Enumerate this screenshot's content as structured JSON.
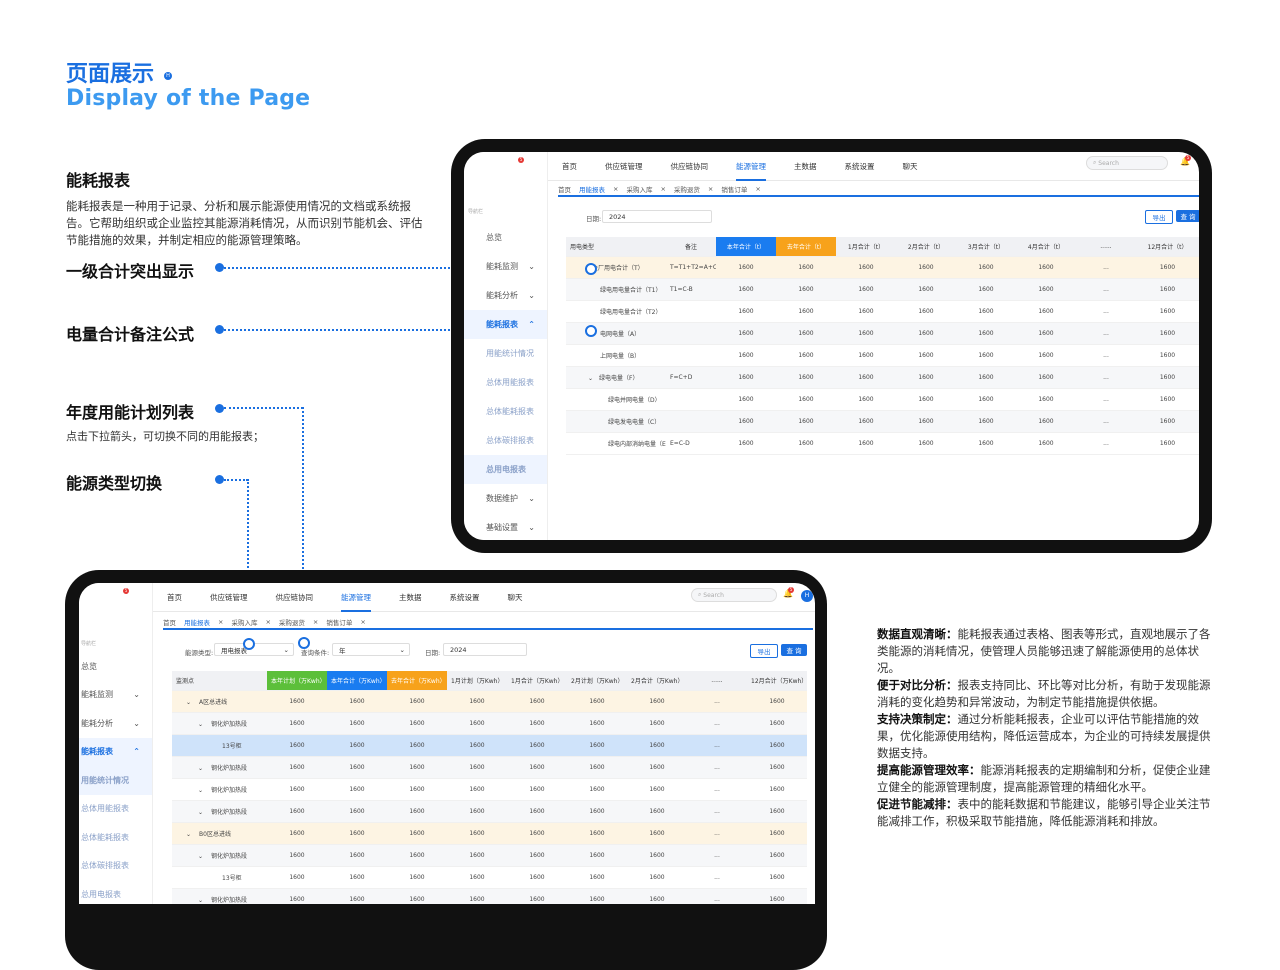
{
  "header": {
    "title_cn": "页面展示",
    "title_en": "Display of the Page",
    "mark": "H"
  },
  "section1": {
    "title": "能耗报表",
    "desc": "能耗报表是一种用于记录、分析和展示能源使用情况的文档或系统报告。它帮助组织或企业监控其能源消耗情况，从而识别节能机会、评估节能措施的效果，并制定相应的能源管理策略。"
  },
  "callouts": {
    "c1": "一级合计突出显示",
    "c2": "电量合计备注公式",
    "c3": "年度用能计划列表",
    "c3_desc": "点击下拉箭头，可切换不同的用能报表；",
    "c4": "能源类型切换"
  },
  "app": {
    "nav": [
      "首页",
      "供应链管理",
      "供应链协同",
      "能源管理",
      "主数据",
      "系统设置",
      "聊天"
    ],
    "nav_active": "能源管理",
    "chat_badge": "5",
    "bell_badge": "5",
    "search_placeholder": "Search",
    "avatar": "H",
    "tabs": [
      "首页",
      "用能报表",
      "采购入库",
      "采购退货",
      "销售订单"
    ],
    "tabs_active": "用能报表",
    "sidebar_caption": "导航栏",
    "sidebar": [
      {
        "label": "总览",
        "arrow": ""
      },
      {
        "label": "能耗监测",
        "arrow": "⌄"
      },
      {
        "label": "能耗分析",
        "arrow": "⌄"
      },
      {
        "label": "能耗报表",
        "arrow": "⌃"
      },
      {
        "label": "用能统计情况",
        "arrow": ""
      },
      {
        "label": "总体用能报表",
        "arrow": ""
      },
      {
        "label": "总体能耗报表",
        "arrow": ""
      },
      {
        "label": "总体碳排报表",
        "arrow": ""
      },
      {
        "label": "总用电报表",
        "arrow": ""
      },
      {
        "label": "数据维护",
        "arrow": "⌄"
      },
      {
        "label": "基础设置",
        "arrow": "⌄"
      }
    ],
    "export_label": "导出",
    "query_label": "查 询",
    "date_label": "日期:",
    "date_value": "2024"
  },
  "table1": {
    "headers": [
      "用电类型",
      "备注",
      "本年合计（t）",
      "去年合计（t）",
      "1月合计（t）",
      "2月合计（t）",
      "3月合计（t）",
      "4月合计（t）",
      "......",
      "12月合计（t）"
    ],
    "rows": [
      {
        "name": "全厂用电合计（T）",
        "note": "T=T1+T2=A+C-B",
        "vals": [
          "1600",
          "1600",
          "1600",
          "1600",
          "1600",
          "1600",
          "...",
          "1600"
        ],
        "style": "hl",
        "indent": 0,
        "caret": ""
      },
      {
        "name": "绿电用电量合计（T1）",
        "note": "T1=C-B",
        "vals": [
          "1600",
          "1600",
          "1600",
          "1600",
          "1600",
          "1600",
          "...",
          "1600"
        ],
        "style": "alt",
        "indent": 1,
        "caret": ""
      },
      {
        "name": "绿电用电量合计（T2）",
        "note": "",
        "vals": [
          "1600",
          "1600",
          "1600",
          "1600",
          "1600",
          "1600",
          "...",
          "1600"
        ],
        "style": "",
        "indent": 1,
        "caret": ""
      },
      {
        "name": "电网电量（A）",
        "note": "",
        "vals": [
          "1600",
          "1600",
          "1600",
          "1600",
          "1600",
          "1600",
          "...",
          "1600"
        ],
        "style": "alt",
        "indent": 1,
        "caret": ""
      },
      {
        "name": "上网电量（B）",
        "note": "",
        "vals": [
          "1600",
          "1600",
          "1600",
          "1600",
          "1600",
          "1600",
          "...",
          "1600"
        ],
        "style": "",
        "indent": 1,
        "caret": ""
      },
      {
        "name": "绿电电量（F）",
        "note": "F=C+D",
        "vals": [
          "1600",
          "1600",
          "1600",
          "1600",
          "1600",
          "1600",
          "...",
          "1600"
        ],
        "style": "alt",
        "indent": 1,
        "caret": "⌄"
      },
      {
        "name": "绿电并网电量（D）",
        "note": "",
        "vals": [
          "1600",
          "1600",
          "1600",
          "1600",
          "1600",
          "1600",
          "...",
          "1600"
        ],
        "style": "",
        "indent": 2,
        "caret": ""
      },
      {
        "name": "绿电发电电量（C）",
        "note": "",
        "vals": [
          "1600",
          "1600",
          "1600",
          "1600",
          "1600",
          "1600",
          "...",
          "1600"
        ],
        "style": "alt",
        "indent": 2,
        "caret": ""
      },
      {
        "name": "绿电内部消纳电量（E）",
        "note": "E=C-D",
        "vals": [
          "1600",
          "1600",
          "1600",
          "1600",
          "1600",
          "1600",
          "...",
          "1600"
        ],
        "style": "",
        "indent": 2,
        "caret": ""
      }
    ]
  },
  "filters2": {
    "energy_label": "能源类型:",
    "energy_value": "用电报表",
    "cond_label": "查询条件:",
    "cond_value": "年",
    "date_label": "日期:",
    "date_value": "2024"
  },
  "table2": {
    "headers": [
      "监测点",
      "本年计划（万Kwh）",
      "本年合计（万Kwh）",
      "去年合计（万Kwh）",
      "1月计划（万Kwh）",
      "1月合计（万Kwh）",
      "2月计划（万Kwh）",
      "2月合计（万Kwh）",
      "......",
      "12月合计（万Kwh）"
    ],
    "rows": [
      {
        "name": "A区总进线",
        "vals": [
          "1600",
          "1600",
          "1600",
          "1600",
          "1600",
          "1600",
          "1600",
          "...",
          "1600"
        ],
        "style": "hl",
        "indent": 0,
        "caret": "⌄"
      },
      {
        "name": "钢化炉加热段",
        "vals": [
          "1600",
          "1600",
          "1600",
          "1600",
          "1600",
          "1600",
          "1600",
          "...",
          "1600"
        ],
        "style": "alt",
        "indent": 1,
        "caret": "⌄"
      },
      {
        "name": "13号柜",
        "vals": [
          "1600",
          "1600",
          "1600",
          "1600",
          "1600",
          "1600",
          "1600",
          "...",
          "1600"
        ],
        "style": "sel",
        "indent": 2,
        "caret": ""
      },
      {
        "name": "钢化炉加热段",
        "vals": [
          "1600",
          "1600",
          "1600",
          "1600",
          "1600",
          "1600",
          "1600",
          "...",
          "1600"
        ],
        "style": "alt",
        "indent": 1,
        "caret": "⌄"
      },
      {
        "name": "钢化炉加热段",
        "vals": [
          "1600",
          "1600",
          "1600",
          "1600",
          "1600",
          "1600",
          "1600",
          "...",
          "1600"
        ],
        "style": "",
        "indent": 1,
        "caret": "⌄"
      },
      {
        "name": "钢化炉加热段",
        "vals": [
          "1600",
          "1600",
          "1600",
          "1600",
          "1600",
          "1600",
          "1600",
          "...",
          "1600"
        ],
        "style": "alt",
        "indent": 1,
        "caret": "⌄"
      },
      {
        "name": "B0区总进线",
        "vals": [
          "1600",
          "1600",
          "1600",
          "1600",
          "1600",
          "1600",
          "1600",
          "...",
          "1600"
        ],
        "style": "hl",
        "indent": 0,
        "caret": "⌄"
      },
      {
        "name": "钢化炉加热段",
        "vals": [
          "1600",
          "1600",
          "1600",
          "1600",
          "1600",
          "1600",
          "1600",
          "...",
          "1600"
        ],
        "style": "alt",
        "indent": 1,
        "caret": "⌄"
      },
      {
        "name": "13号柜",
        "vals": [
          "1600",
          "1600",
          "1600",
          "1600",
          "1600",
          "1600",
          "1600",
          "...",
          "1600"
        ],
        "style": "",
        "indent": 2,
        "caret": ""
      },
      {
        "name": "钢化炉加热段",
        "vals": [
          "1600",
          "1600",
          "1600",
          "1600",
          "1600",
          "1600",
          "1600",
          "...",
          "1600"
        ],
        "style": "alt",
        "indent": 1,
        "caret": "⌄"
      }
    ]
  },
  "benefits": [
    {
      "label": "数据直观清晰：",
      "text": "能耗报表通过表格、图表等形式，直观地展示了各类能源的消耗情况，使管理人员能够迅速了解能源使用的总体状况。"
    },
    {
      "label": "便于对比分析：",
      "text": "报表支持同比、环比等对比分析，有助于发现能源消耗的变化趋势和异常波动，为制定节能措施提供依据。"
    },
    {
      "label": "支持决策制定：",
      "text": "通过分析能耗报表，企业可以评估节能措施的效果，优化能源使用结构，降低运营成本，为企业的可持续发展提供数据支持。"
    },
    {
      "label": "提高能源管理效率：",
      "text": "能源消耗报表的定期编制和分析，促使企业建立健全的能源管理制度，提高能源管理的精细化水平。"
    },
    {
      "label": "促进节能减排：",
      "text": "表中的能耗数据和节能建议，能够引导企业关注节能减排工作，积极采取节能措施，降低能源消耗和排放。"
    }
  ]
}
